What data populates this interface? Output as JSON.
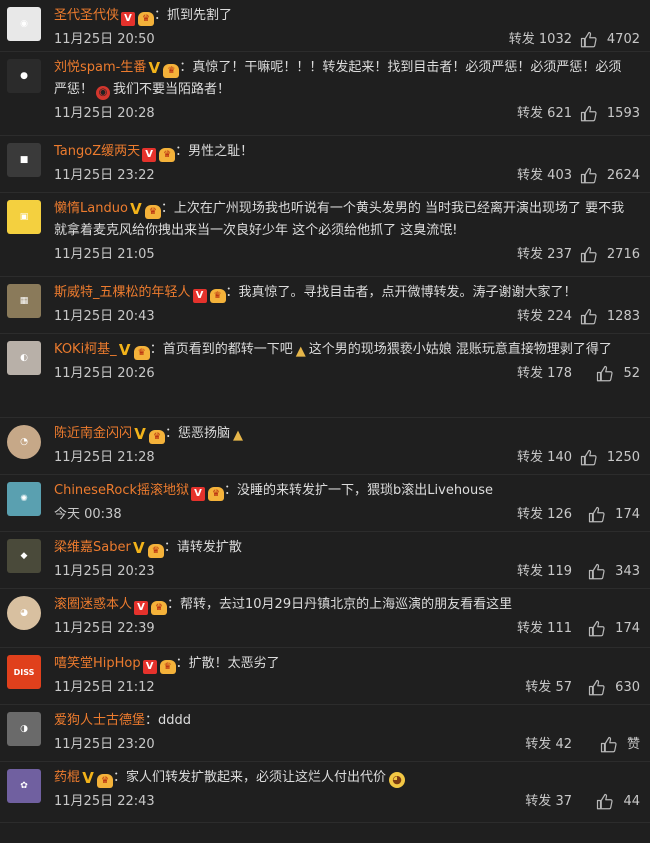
{
  "ui": {
    "repost_label": "转发",
    "icons": {
      "like": "thumb-up-icon",
      "verified": "verified-v-icon",
      "fan": "fan-badge-icon"
    }
  },
  "comments": [
    {
      "user": "圣代圣代侠",
      "badge": "red",
      "text": "：抓到先割了",
      "text_after": "",
      "emoji": "",
      "time": "11月25日 20:50",
      "reposts": "1032",
      "likes": "4702",
      "h": 52,
      "avatar": "#e8e8e8"
    },
    {
      "user": "刘悦spam-生番",
      "badge": "gold",
      "text": "：真惊了！干嘛呢！！！转发起来！找到目击者！必须严惩！必须严惩！必须严惩！",
      "text_after": "我们不要当陌路者！",
      "emoji": "angry",
      "time": "11月25日 20:28",
      "reposts": "621",
      "likes": "1593",
      "h": 84,
      "avatar": "#2b2b2b"
    },
    {
      "user": "TangoZ缓两天",
      "badge": "red",
      "text": "：男性之耻！",
      "text_after": "",
      "emoji": "",
      "time": "11月25日 23:22",
      "reposts": "403",
      "likes": "2624",
      "h": 57,
      "avatar": "#3a3a3a"
    },
    {
      "user": "懒惰Landuo",
      "badge": "gold",
      "text": "：上次在广州现场我也听说有一个黄头发男的 当时我已经离开演出现场了 要不我就拿着麦克风给你拽出来当一次良好少年 这个必须给他抓了 这臭流氓!",
      "text_after": "",
      "emoji": "",
      "time": "11月25日 21:05",
      "reposts": "237",
      "likes": "2716",
      "h": 84,
      "avatar": "#f4d03f"
    },
    {
      "user": "斯威特_五棵松的年轻人",
      "badge": "red",
      "text": "：我真惊了。寻找目击者，点开微博转发。涛子谢谢大家了！",
      "text_after": "",
      "emoji": "",
      "time": "11月25日 20:43",
      "reposts": "224",
      "likes": "1283",
      "h": 57,
      "avatar": "#8a7a5a"
    },
    {
      "user": "KOKi柯基_",
      "badge": "gold",
      "text": "：首页看到的都转一下吧",
      "text_after": "这个男的现场猥亵小姑娘 混账玩意直接物理剥了得了",
      "emoji": "pray",
      "time": "11月25日 20:26",
      "reposts": "178",
      "likes": "52",
      "h": 84,
      "avatar": "#b8b0a8"
    },
    {
      "user": "陈近南金闪闪",
      "badge": "gold",
      "text": "：惩恶扬脑",
      "text_after": "",
      "emoji": "pray",
      "time": "11月25日 21:28",
      "reposts": "140",
      "likes": "1250",
      "h": 57,
      "avatar": "#c6a888"
    },
    {
      "user": "ChineseRock摇滚地狱",
      "badge": "red",
      "text": "：没睡的来转发扩一下，猥琐b滚出Livehouse",
      "text_after": "",
      "emoji": "",
      "time": "今天 00:38",
      "reposts": "126",
      "likes": "174",
      "h": 57,
      "avatar": "#5aa0b0"
    },
    {
      "user": "梁维嘉Saber",
      "badge": "gold",
      "text": "：请转发扩散",
      "text_after": "",
      "emoji": "",
      "time": "11月25日 20:23",
      "reposts": "119",
      "likes": "343",
      "h": 57,
      "avatar": "#4a4a3a"
    },
    {
      "user": "滚圈迷惑本人",
      "badge": "red",
      "text": "：帮转，去过10月29日丹镇北京的上海巡演的朋友看看这里",
      "text_after": "",
      "emoji": "",
      "time": "11月25日 22:39",
      "reposts": "111",
      "likes": "174",
      "h": 59,
      "avatar": "#d8c0a0"
    },
    {
      "user": "嘻笑堂HipHop",
      "badge": "red",
      "text": "：扩散！太恶劣了",
      "text_after": "",
      "emoji": "",
      "time": "11月25日 21:12",
      "reposts": "57",
      "likes": "630",
      "h": 57,
      "avatar": "#e0401c"
    },
    {
      "user": "爱狗人士古德堡",
      "badge": "none",
      "text": "：dddd",
      "text_after": "",
      "emoji": "",
      "time": "11月25日 23:20",
      "reposts": "42",
      "likes": "赞",
      "h": 57,
      "avatar": "#6a6a6a"
    },
    {
      "user": "药棍",
      "badge": "gold",
      "text": "：家人们转发扩散起来，必须让这烂人付出代价",
      "text_after": "",
      "emoji": "sad",
      "time": "11月25日 22:43",
      "reposts": "37",
      "likes": "44",
      "h": 61,
      "avatar": "#7060a0"
    }
  ]
}
